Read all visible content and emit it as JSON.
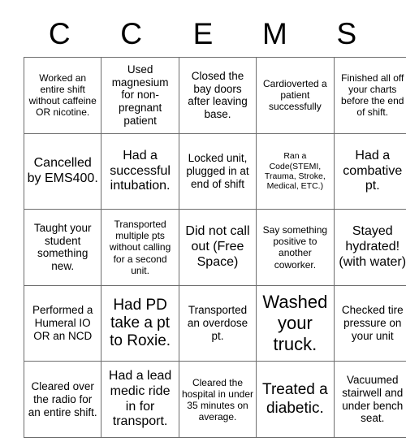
{
  "card": {
    "headers": [
      "C",
      "C",
      "E",
      "M",
      "S"
    ],
    "border_color": "#6e6e6e",
    "background_color": "#ffffff",
    "text_color": "#000000",
    "rows": [
      [
        {
          "text": "Worked an entire shift without caffeine OR nicotine.",
          "size": "s"
        },
        {
          "text": "Used magnesium for non-pregnant patient",
          "size": "m"
        },
        {
          "text": "Closed the bay doors after leaving base.",
          "size": "m"
        },
        {
          "text": "Cardioverted a patient successfully",
          "size": "s"
        },
        {
          "text": "Finished all off your charts before the end of shift.",
          "size": "s"
        }
      ],
      [
        {
          "text": "Cancelled by EMS400.",
          "size": "l"
        },
        {
          "text": "Had a successful intubation.",
          "size": "l"
        },
        {
          "text": "Locked unit, plugged in at end of shift",
          "size": "m"
        },
        {
          "text": "Ran a Code(STEMI, Trauma, Stroke, Medical, ETC.)",
          "size": "xs"
        },
        {
          "text": "Had a combative pt.",
          "size": "l"
        }
      ],
      [
        {
          "text": "Taught your student something new.",
          "size": "m"
        },
        {
          "text": "Transported multiple pts without calling for a second unit.",
          "size": "s"
        },
        {
          "text": "Did not call out (Free Space)",
          "size": "l"
        },
        {
          "text": "Say something positive to another coworker.",
          "size": "s"
        },
        {
          "text": "Stayed hydrated! (with water)",
          "size": "l"
        }
      ],
      [
        {
          "text": "Performed a Humeral IO OR an NCD",
          "size": "m"
        },
        {
          "text": "Had PD take a pt to Roxie.",
          "size": "xl"
        },
        {
          "text": "Transported an overdose pt.",
          "size": "m"
        },
        {
          "text": "Washed your truck.",
          "size": "xxl"
        },
        {
          "text": "Checked tire pressure on your unit",
          "size": "m"
        }
      ],
      [
        {
          "text": "Cleared over the radio for an entire shift.",
          "size": "m"
        },
        {
          "text": "Had a lead medic ride in for transport.",
          "size": "l"
        },
        {
          "text": "Cleared the hospital in under 35 minutes on average.",
          "size": "s"
        },
        {
          "text": "Treated a diabetic.",
          "size": "xl"
        },
        {
          "text": "Vacuumed stairwell and under bench seat.",
          "size": "m"
        }
      ]
    ]
  }
}
